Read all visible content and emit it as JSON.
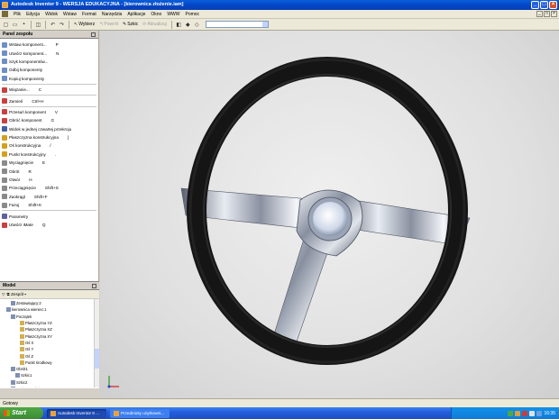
{
  "window": {
    "title": "Autodesk Inventor 9 - WERSJA EDUKACYJNA - [kierownica złożenie.iam]",
    "controls": [
      "_",
      "□",
      "×"
    ]
  },
  "menu": [
    "Plik",
    "Edycja",
    "Widok",
    "Wstaw",
    "Format",
    "Narzędzia",
    "Aplikacje",
    "Okno",
    "WWW",
    "Pomoc"
  ],
  "toolbar": {
    "select_label": "Wybierz",
    "return_label": "Powrót",
    "sketch_label": "Szkic",
    "update_label": "Aktualizuj"
  },
  "assembly_panel": {
    "title": "Panel zespołu",
    "commands": [
      {
        "label": "Wstaw komponent...",
        "shortcut": "P",
        "color": "#6f8fc4"
      },
      {
        "label": "Utwórz komponent...",
        "shortcut": "N",
        "color": "#6f8fc4"
      },
      {
        "label": "Szyk komponentów...",
        "shortcut": "",
        "color": "#6f8fc4"
      },
      {
        "label": "Odbij komponenty",
        "shortcut": "",
        "color": "#6f8fc4"
      },
      {
        "label": "Kopiuj komponenty",
        "shortcut": "",
        "color": "#6f8fc4"
      },
      {
        "sep": true
      },
      {
        "label": "Wiązanie...",
        "shortcut": "C",
        "color": "#c84040"
      },
      {
        "sep": true
      },
      {
        "label": "Zamień",
        "shortcut": "Ctrl+H",
        "color": "#c84040"
      },
      {
        "sep": true
      },
      {
        "label": "Przesuń komponent",
        "shortcut": "V",
        "color": "#c84040"
      },
      {
        "label": "Obróć komponent",
        "shortcut": "G",
        "color": "#c84040"
      },
      {
        "label": "Widok w jednej czwartej przekroju",
        "shortcut": "",
        "color": "#4060a0"
      },
      {
        "label": "Płaszczyzna konstrukcyjna",
        "shortcut": "]",
        "color": "#d4a020"
      },
      {
        "label": "Oś konstrukcyjna",
        "shortcut": "/",
        "color": "#d4a020"
      },
      {
        "label": "Punkt konstrukcyjny",
        "shortcut": ".",
        "color": "#d4a020"
      },
      {
        "label": "Wyciągnięcie",
        "shortcut": "E",
        "color": "#8a8a8a"
      },
      {
        "label": "Obrót",
        "shortcut": "R",
        "color": "#8a8a8a"
      },
      {
        "label": "Otwór",
        "shortcut": "H",
        "color": "#8a8a8a"
      },
      {
        "label": "Przeciągnięcie",
        "shortcut": "Shift+S",
        "color": "#8a8a8a"
      },
      {
        "label": "Zaokrągl",
        "shortcut": "Shift+F",
        "color": "#8a8a8a"
      },
      {
        "label": "Fazuj",
        "shortcut": "Shift+K",
        "color": "#8a8a8a"
      },
      {
        "sep": true
      },
      {
        "label": "Parametry",
        "shortcut": "",
        "color": "#6060a0"
      },
      {
        "label": "Utwórz iMate",
        "shortcut": "Q",
        "color": "#c84040"
      }
    ]
  },
  "model_panel": {
    "title": "Model",
    "filter_label": "Zespół",
    "tree": [
      {
        "label": "Zestawiający:2",
        "indent": 2
      },
      {
        "label": "kierownica wieniec:1",
        "indent": 1
      },
      {
        "label": "Początek",
        "indent": 2
      },
      {
        "label": "Płaszczyzna YZ",
        "indent": 4
      },
      {
        "label": "Płaszczyzna XZ",
        "indent": 4
      },
      {
        "label": "Płaszczyzna XY",
        "indent": 4
      },
      {
        "label": "Oś X",
        "indent": 4
      },
      {
        "label": "Oś Y",
        "indent": 4
      },
      {
        "label": "Oś Z",
        "indent": 4
      },
      {
        "label": "Punkt środkowy",
        "indent": 4
      },
      {
        "label": "Obrót1",
        "indent": 2
      },
      {
        "label": "Szkic1",
        "indent": 3
      },
      {
        "label": "Szkic2",
        "indent": 2
      },
      {
        "label": "Koniec części",
        "indent": 2
      }
    ]
  },
  "status": "Gotowy",
  "taskbar": {
    "start_label": "Start",
    "tasks": [
      "Autodesk Inventor 9 ...",
      "Przedmioty użytkowni..."
    ],
    "clock": "16:35"
  }
}
